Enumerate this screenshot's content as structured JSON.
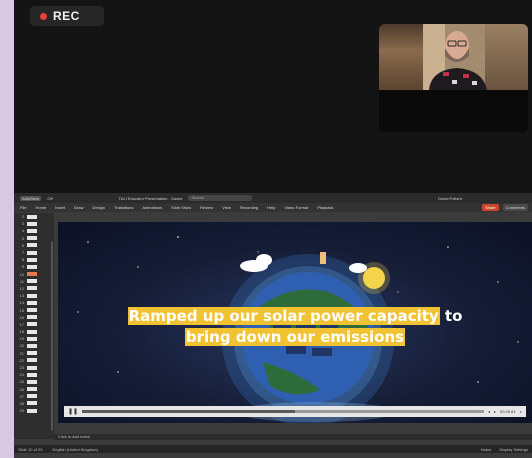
{
  "recording": {
    "label": "REC",
    "indicator_color": "#e8433b"
  },
  "window": {
    "autosave": "AutoSave",
    "autosave_state": "Off",
    "file_title": "TALI Educator Presentation - Saved",
    "search_placeholder": "Search",
    "user_name": "David Pollard"
  },
  "ribbon": {
    "tabs": [
      "File",
      "Home",
      "Insert",
      "Draw",
      "Design",
      "Transitions",
      "Animations",
      "Slide Show",
      "Review",
      "View",
      "Recording",
      "Help",
      "Video Format",
      "Playback"
    ],
    "share_label": "Share",
    "comments_label": "Comments"
  },
  "thumbnails": [
    "2",
    "3",
    "4",
    "5",
    "6",
    "7",
    "8",
    "9",
    "10",
    "11",
    "12",
    "13",
    "14",
    "15",
    "16",
    "17",
    "18",
    "19",
    "20",
    "21",
    "22",
    "23",
    "24",
    "25",
    "26",
    "27",
    "28",
    "29"
  ],
  "active_slide": "10",
  "slide": {
    "caption_line1_highlight": "Ramped up our solar power capacity",
    "caption_line1_rest": " to",
    "caption_line2_highlight": "bring down our emissions",
    "highlight_color": "#f1c232",
    "video_time": "00:29.61",
    "video_progress": 0.53
  },
  "notes_placeholder": "Click to add notes",
  "status": {
    "slide_counter": "Slide 10 of 29",
    "language": "English (United Kingdom)",
    "notes": "Notes",
    "display_settings": "Display Settings"
  }
}
